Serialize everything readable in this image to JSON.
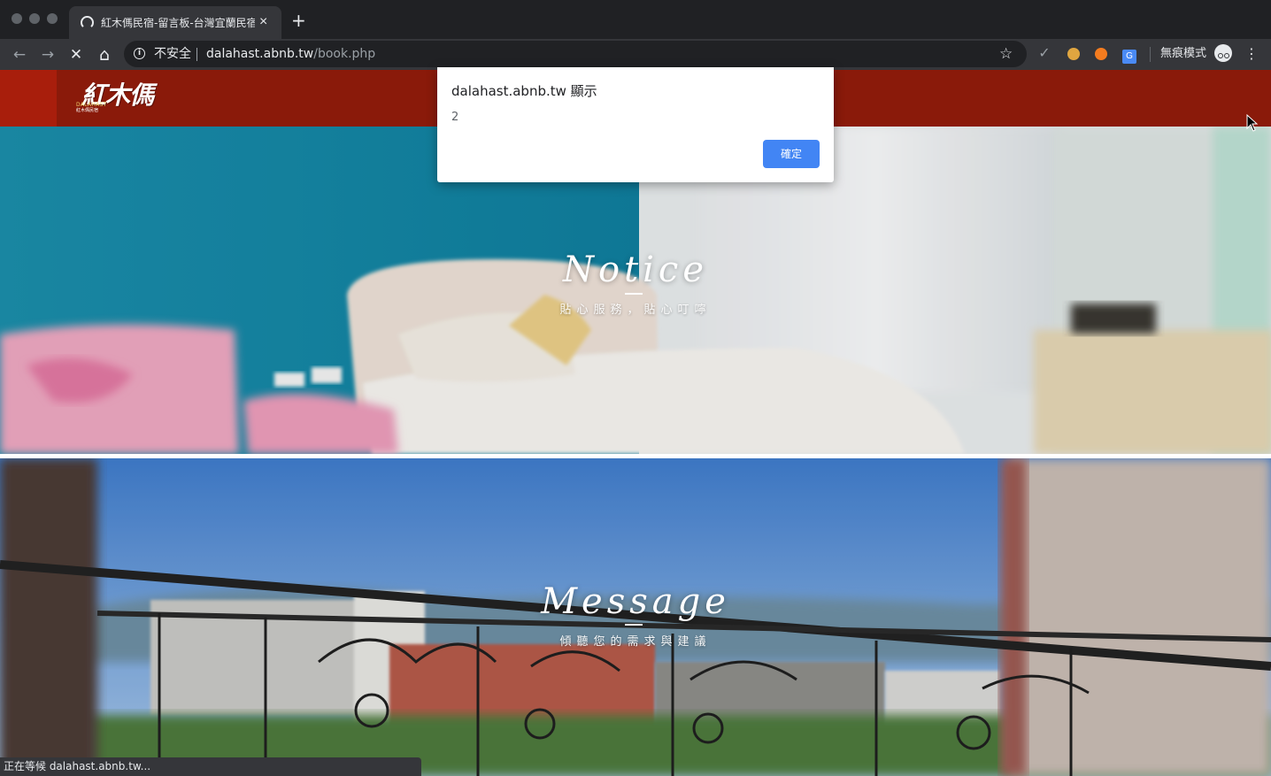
{
  "browser": {
    "tab": {
      "title": "紅木傌民宿-留言板-台灣宜蘭民宿",
      "close_glyph": "×"
    },
    "new_tab_glyph": "+",
    "nav": {
      "back": "←",
      "forward": "→",
      "stop": "✕",
      "home": "⌂"
    },
    "address": {
      "security_label": "不安全",
      "url_host": "dalahast.abnb.tw",
      "url_path": "/book.php"
    },
    "bookmark_glyph": "☆",
    "extensions": {
      "check_glyph": "✓",
      "translate_glyph": "G"
    },
    "incognito_label": "無痕模式",
    "menu_glyph": "⋮"
  },
  "site": {
    "logo": {
      "main": "紅木傌",
      "sub_en": "DALAHAST",
      "sub_zh": "紅木傌民宿"
    },
    "sections": [
      {
        "title": "Notice",
        "subtitle": "貼心服務，貼心叮嚀"
      },
      {
        "title": "Message",
        "subtitle": "傾聽您的需求與建議"
      }
    ]
  },
  "dialog": {
    "title": "dalahast.abnb.tw 顯示",
    "message": "2",
    "ok_label": "確定"
  },
  "status_bar": {
    "text": "正在等候 dalahast.abnb.tw..."
  },
  "colors": {
    "chrome_dark": "#202124",
    "chrome_toolbar": "#35363a",
    "header_red": "#8a1a0a",
    "dialog_button": "#4285f4"
  }
}
